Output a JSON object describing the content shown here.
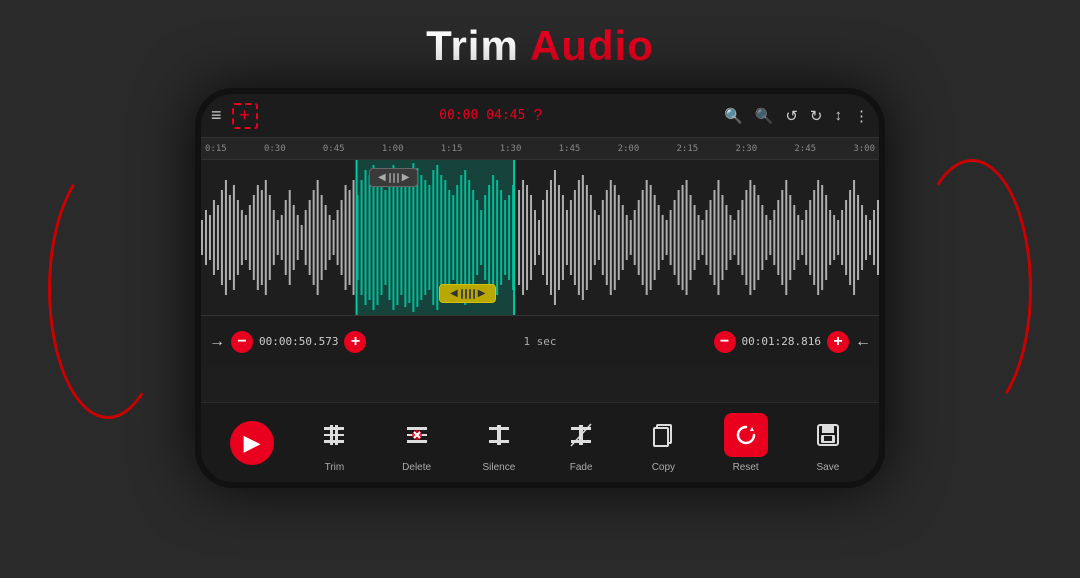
{
  "title": {
    "prefix": "Trim ",
    "suffix": "Audio"
  },
  "phone": {
    "topbar": {
      "time_left": "00:00",
      "time_right": "04:45",
      "icons": [
        "≡",
        "+",
        "?",
        "⊕",
        "⊖",
        "↺",
        "↻",
        "↕",
        "⋮"
      ]
    },
    "ruler": {
      "marks": [
        "0:15",
        "0:30",
        "0:45",
        "1:00",
        "1:15",
        "1:30",
        "1:45",
        "2:00",
        "2:15",
        "2:30",
        "2:45",
        "3:00"
      ]
    },
    "controls": {
      "arrow_left": "→",
      "minus_left": "−",
      "time_left": "00:00:50.573",
      "plus_left": "+",
      "interval": "1 sec",
      "minus_right": "−",
      "time_right": "00:01:28.816",
      "plus_right": "+",
      "arrow_right": "←"
    },
    "actions": [
      {
        "id": "play",
        "label": "",
        "icon": "▶",
        "type": "play"
      },
      {
        "id": "trim",
        "label": "Trim",
        "icon": "trim",
        "type": "normal"
      },
      {
        "id": "delete",
        "label": "Delete",
        "icon": "delete",
        "type": "normal"
      },
      {
        "id": "silence",
        "label": "Silence",
        "icon": "silence",
        "type": "normal"
      },
      {
        "id": "fade",
        "label": "Fade",
        "icon": "fade",
        "type": "normal"
      },
      {
        "id": "copy",
        "label": "Copy",
        "icon": "copy",
        "type": "normal"
      },
      {
        "id": "reset",
        "label": "Reset",
        "icon": "reset",
        "type": "reset"
      },
      {
        "id": "save",
        "label": "Save",
        "icon": "save",
        "type": "normal"
      }
    ],
    "colors": {
      "red": "#e8001e",
      "teal": "#00c8a0",
      "dark_bg": "#1e1e1e"
    }
  }
}
